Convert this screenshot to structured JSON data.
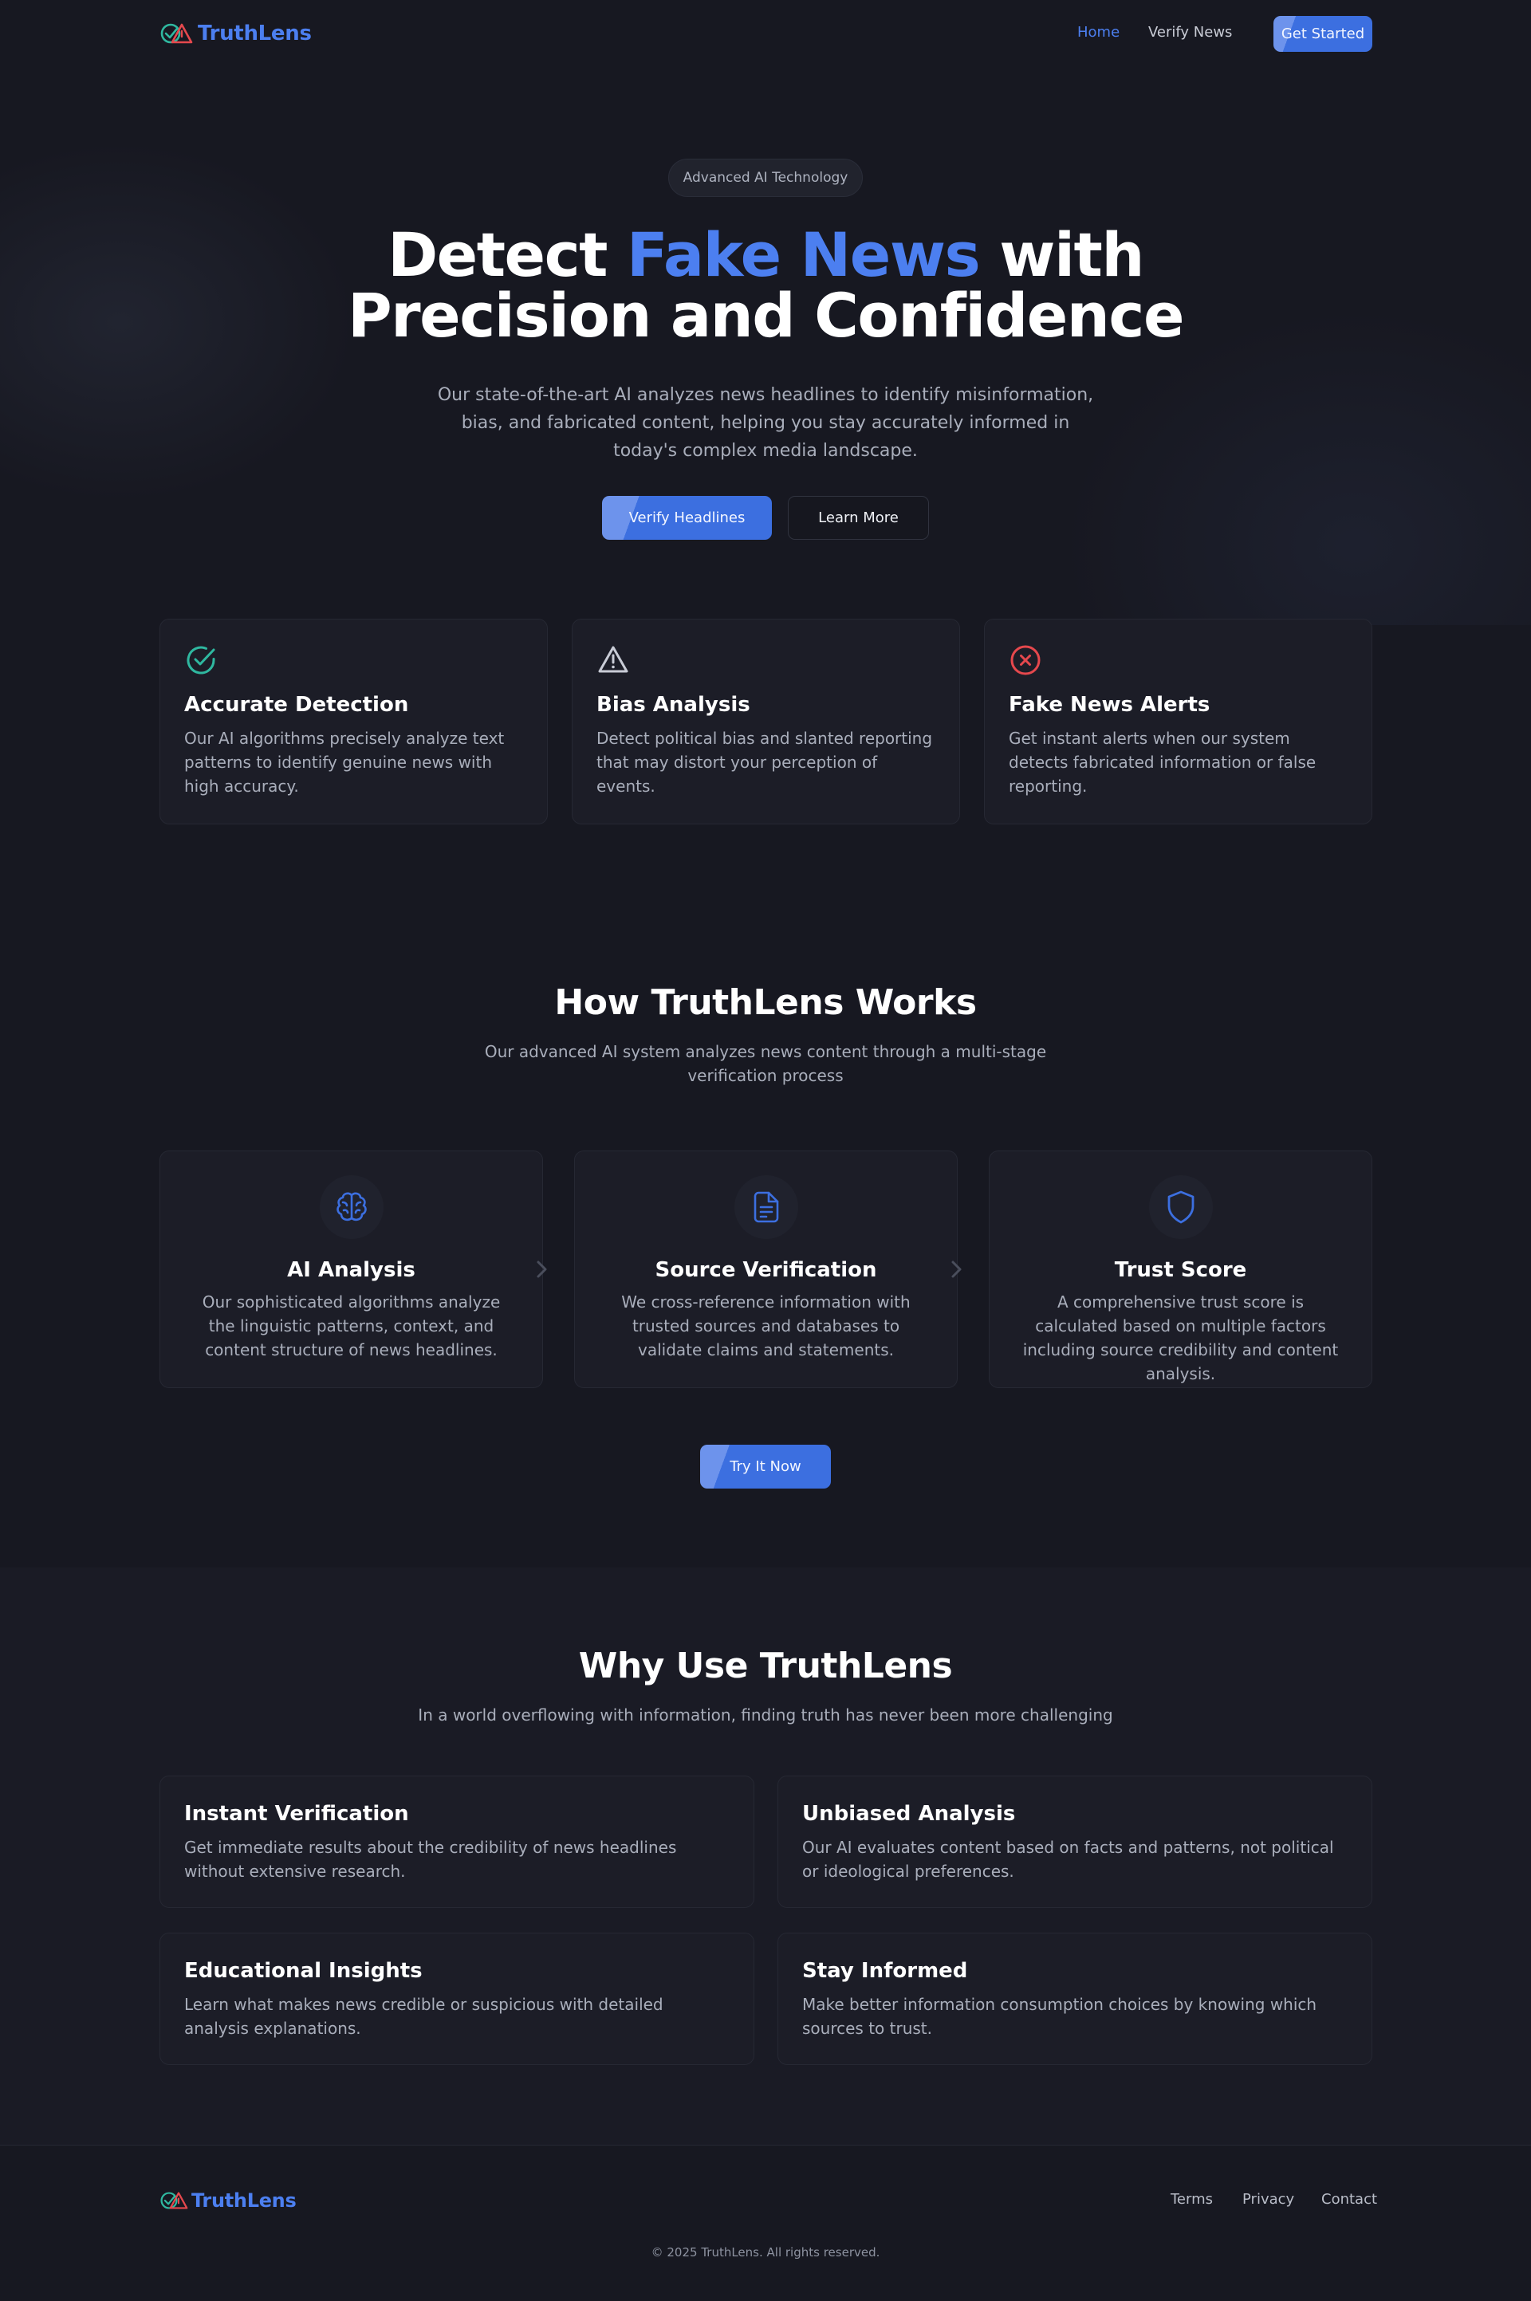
{
  "brand": {
    "name": "TruthLens",
    "accent": "#4c7ff0",
    "check_color": "#2fb8a0",
    "alert_color": "#e5484d"
  },
  "nav": {
    "links": [
      {
        "label": "Home",
        "active": true
      },
      {
        "label": "Verify News",
        "active": false
      }
    ],
    "cta": "Get Started"
  },
  "hero": {
    "badge": "Advanced AI Technology",
    "title_pre": "Detect ",
    "title_highlight": "Fake News",
    "title_post": " with",
    "title_line2": "Precision and Confidence",
    "subtitle": "Our state-of-the-art AI analyzes news headlines to identify misinformation, bias, and fabricated content, helping you stay accurately informed in today's complex media landscape.",
    "primary_button": "Verify Headlines",
    "secondary_button": "Learn More"
  },
  "features": [
    {
      "icon": "check-circle-icon",
      "title": "Accurate Detection",
      "description": "Our AI algorithms precisely analyze text patterns to identify genuine news with high accuracy."
    },
    {
      "icon": "warning-triangle-icon",
      "title": "Bias Analysis",
      "description": "Detect political bias and slanted reporting that may distort your perception of events."
    },
    {
      "icon": "x-circle-icon",
      "title": "Fake News Alerts",
      "description": "Get instant alerts when our system detects fabricated information or false reporting."
    }
  ],
  "how": {
    "title": "How TruthLens Works",
    "subtitle": "Our advanced AI system analyzes news content through a multi-stage verification process",
    "steps": [
      {
        "icon": "brain-icon",
        "title": "AI Analysis",
        "description": "Our sophisticated algorithms analyze the linguistic patterns, context, and content structure of news headlines."
      },
      {
        "icon": "document-icon",
        "title": "Source Verification",
        "description": "We cross-reference information with trusted sources and databases to validate claims and statements."
      },
      {
        "icon": "shield-icon",
        "title": "Trust Score",
        "description": "A comprehensive trust score is calculated based on multiple factors including source credibility and content analysis."
      }
    ],
    "cta": "Try It Now"
  },
  "why": {
    "title": "Why Use TruthLens",
    "subtitle": "In a world overflowing with information, finding truth has never been more challenging",
    "cards": [
      {
        "title": "Instant Verification",
        "description": "Get immediate results about the credibility of news headlines without extensive research."
      },
      {
        "title": "Unbiased Analysis",
        "description": "Our AI evaluates content based on facts and patterns, not political or ideological preferences."
      },
      {
        "title": "Educational Insights",
        "description": "Learn what makes news credible or suspicious with detailed analysis explanations."
      },
      {
        "title": "Stay Informed",
        "description": "Make better information consumption choices by knowing which sources to trust."
      }
    ]
  },
  "footer": {
    "links": [
      "Terms",
      "Privacy",
      "Contact"
    ],
    "copyright": "© 2025 TruthLens. All rights reserved."
  }
}
